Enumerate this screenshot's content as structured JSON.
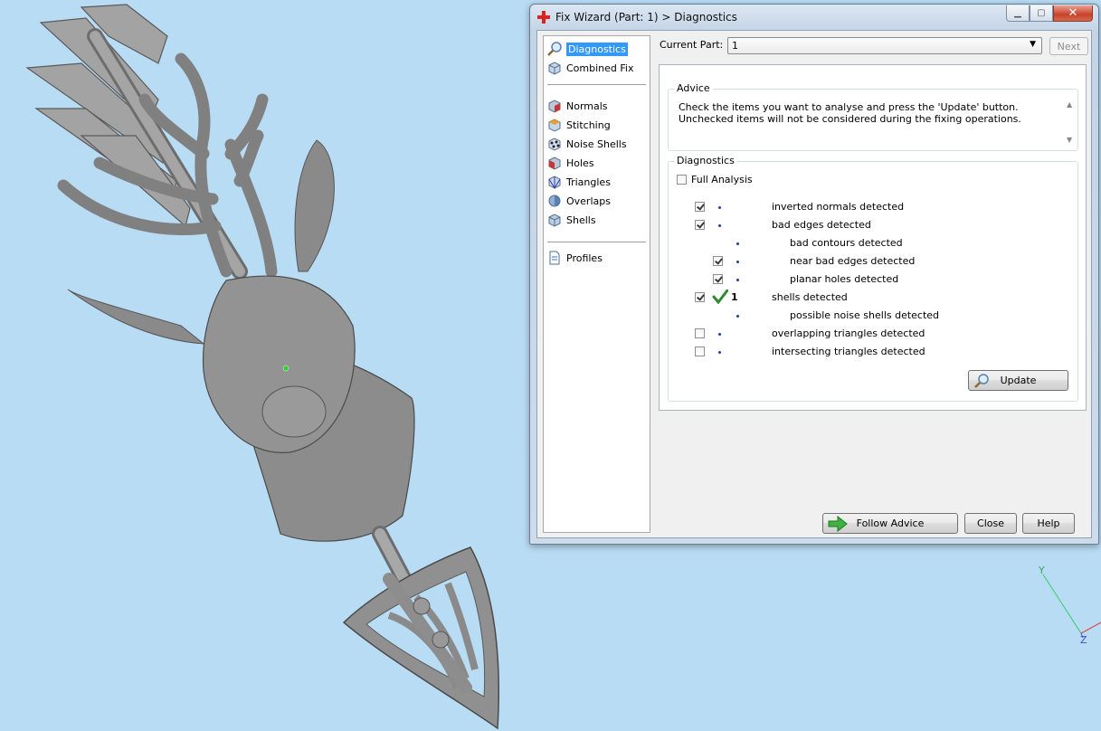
{
  "window": {
    "title": "Fix Wizard (Part: 1) > Diagnostics"
  },
  "nav": {
    "items": [
      {
        "label": "Diagnostics",
        "icon": "magnifier-icon",
        "selected": true
      },
      {
        "label": "Combined Fix",
        "icon": "cube-icon"
      },
      {
        "label": "Normals",
        "icon": "normals-cube-icon"
      },
      {
        "label": "Stitching",
        "icon": "stitching-cube-icon"
      },
      {
        "label": "Noise Shells",
        "icon": "noise-shells-icon"
      },
      {
        "label": "Holes",
        "icon": "holes-cube-icon"
      },
      {
        "label": "Triangles",
        "icon": "triangles-cube-icon"
      },
      {
        "label": "Overlaps",
        "icon": "overlaps-icon"
      },
      {
        "label": "Shells",
        "icon": "shells-cube-icon"
      },
      {
        "label": "Profiles",
        "icon": "document-icon"
      }
    ]
  },
  "current_part": {
    "label": "Current Part:",
    "value": "1"
  },
  "next_button": "Next",
  "advice": {
    "title": "Advice",
    "text": "Check the items you want to analyse and press the 'Update' button. Unchecked items will not be considered during the fixing operations."
  },
  "diagnostics": {
    "title": "Diagnostics",
    "full_analysis": {
      "label": "Full Analysis",
      "checked": false
    },
    "rows": [
      {
        "label": "inverted normals detected",
        "checked": true,
        "level": 0
      },
      {
        "label": "bad edges detected",
        "checked": true,
        "level": 0
      },
      {
        "label": "bad contours detected",
        "checked": null,
        "level": 1
      },
      {
        "label": "near bad edges detected",
        "checked": true,
        "level": 1
      },
      {
        "label": "planar holes detected",
        "checked": true,
        "level": 1
      },
      {
        "label": "shells detected",
        "checked": true,
        "level": 0,
        "status": "ok",
        "count": "1"
      },
      {
        "label": "possible noise shells detected",
        "checked": null,
        "level": 1
      },
      {
        "label": "overlapping triangles detected",
        "checked": false,
        "level": 0
      },
      {
        "label": "intersecting triangles detected",
        "checked": false,
        "level": 0
      }
    ],
    "update_button": "Update"
  },
  "footer": {
    "follow_advice": "Follow Advice",
    "close": "Close",
    "help": "Help"
  },
  "axis_labels": {
    "y": "Y",
    "z": "Z"
  },
  "colors": {
    "viewport_bg": "#b9dcf5",
    "model": "#8f8f8f",
    "selection": "#3399ff",
    "check_ok": "#2e8b2e"
  }
}
